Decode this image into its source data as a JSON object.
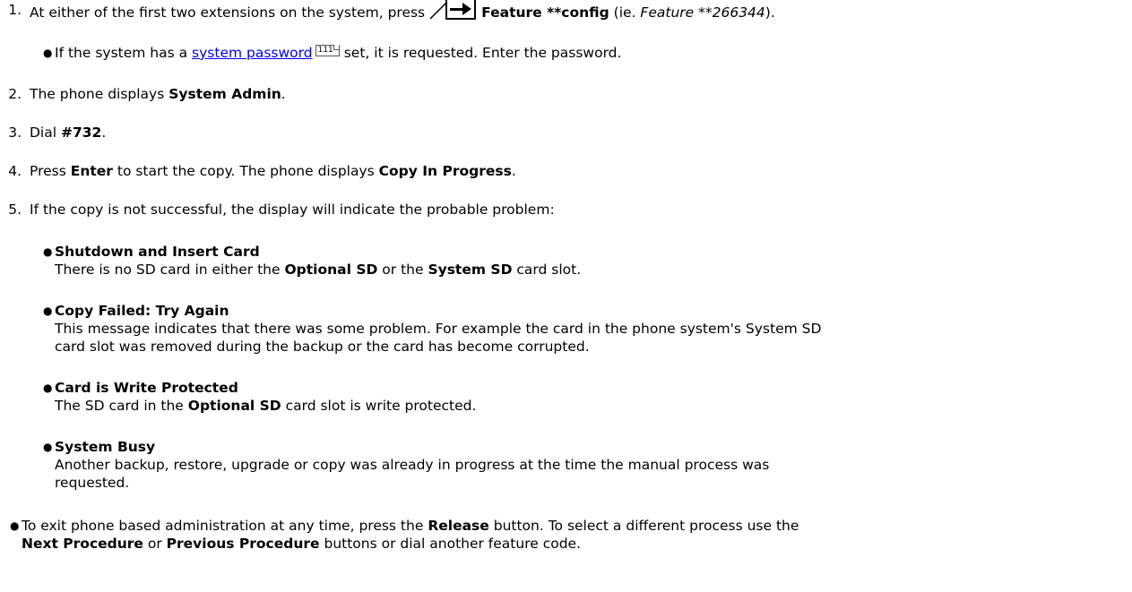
{
  "step1": {
    "num": "1.",
    "pre": "At either of the first two extensions on the system, press",
    "icon": "feature-key-icon",
    "bold": "Feature **config",
    "mid": " (ie. ",
    "italic": "Feature **266344",
    "post": ")."
  },
  "step1_sub": {
    "pre": "If the system has a ",
    "link": "system password",
    "ref": "111",
    "post": " set, it is requested. Enter the password."
  },
  "step2": {
    "num": "2.",
    "pre": "The phone displays ",
    "bold": "System Admin",
    "post": "."
  },
  "step3": {
    "num": "3.",
    "pre": "Dial ",
    "bold": "#732",
    "post": "."
  },
  "step4": {
    "num": "4.",
    "pre": "Press ",
    "bold1": "Enter",
    "mid": " to start the copy. The phone displays ",
    "bold2": "Copy In Progress",
    "post": "."
  },
  "step5": {
    "num": "5.",
    "text": "If the copy is not successful, the display will indicate the probable problem:"
  },
  "problems": [
    {
      "title": "Shutdown and Insert Card",
      "line1_pre": "There is no SD card in either the ",
      "line1_b1": "Optional SD",
      "line1_mid": " or the ",
      "line1_b2": "System SD",
      "line1_post": " card slot."
    },
    {
      "title": "Copy Failed: Try Again",
      "line1": "This message indicates that there was some problem. For example the card in the phone system's System SD",
      "line2": "card slot was removed during the backup or the card has become corrupted."
    },
    {
      "title": "Card is Write Protected",
      "line1_pre": "The SD card in the ",
      "line1_b": "Optional SD",
      "line1_post": " card slot is write protected."
    },
    {
      "title": "System Busy",
      "line1": "Another backup, restore, upgrade or copy was already in progress at the time the manual process was",
      "line2": "requested."
    }
  ],
  "note": {
    "pre": "To exit phone based administration at any time, press the ",
    "b1": "Release",
    "mid1": " button. To select a different process use the",
    "b2": "Next Procedure",
    "mid2": " or ",
    "b3": "Previous Procedure",
    "post": " buttons or dial another feature code."
  }
}
